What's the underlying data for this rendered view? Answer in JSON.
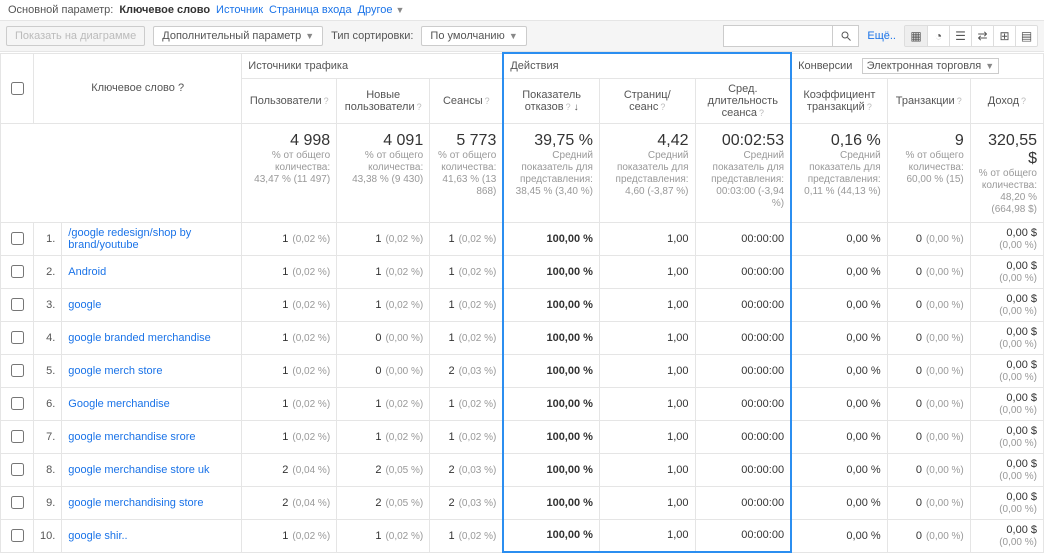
{
  "topbar": {
    "param_label": "Основной параметр:",
    "primary_dim": "Ключевое слово",
    "links": [
      "Источник",
      "Страница входа",
      "Другое"
    ]
  },
  "toolbar": {
    "chart_btn": "Показать на диаграмме",
    "secondary_dim": "Дополнительный параметр",
    "sort_type_label": "Тип сортировки:",
    "sort_default": "По умолчанию",
    "more": "Ещё..",
    "search_placeholder": ""
  },
  "headers": {
    "keyword": "Ключевое слово",
    "group_traffic": "Источники трафика",
    "group_actions": "Действия",
    "group_conv": "Конверсии",
    "conv_select": "Электронная торговля",
    "users": "Пользователи",
    "new_users": "Новые пользователи",
    "sessions": "Сеансы",
    "bounce": "Показатель отказов",
    "pages": "Страниц/сеанс",
    "avg_dur": "Сред. длительность сеанса",
    "trans_rate": "Коэффициент транзакций",
    "trans": "Транзакции",
    "revenue": "Доход"
  },
  "summary": {
    "users": {
      "big": "4 998",
      "l1": "% от общего количества:",
      "l2": "43,47 % (11 497)"
    },
    "new_users": {
      "big": "4 091",
      "l1": "% от общего количества:",
      "l2": "43,38 % (9 430)"
    },
    "sessions": {
      "big": "5 773",
      "l1": "% от общего количества:",
      "l2": "41,63 % (13 868)"
    },
    "bounce": {
      "big": "39,75 %",
      "l1": "Средний показатель для представления:",
      "l2": "38,45 % (3,40 %)"
    },
    "pages": {
      "big": "4,42",
      "l1": "Средний показатель для представления:",
      "l2": "4,60 (-3,87 %)"
    },
    "avg_dur": {
      "big": "00:02:53",
      "l1": "Средний показатель для представления:",
      "l2": "00:03:00 (-3,94 %)"
    },
    "trans_rate": {
      "big": "0,16 %",
      "l1": "Средний показатель для представления:",
      "l2": "0,11 % (44,13 %)"
    },
    "trans": {
      "big": "9",
      "l1": "% от общего количества:",
      "l2": "60,00 % (15)"
    },
    "revenue": {
      "big": "320,55 $",
      "l1": "% от общего количества:",
      "l2": "48,20 % (664,98 $)"
    }
  },
  "rows": [
    {
      "idx": "1.",
      "kw": "/google redesign/shop by brand/youtube",
      "u": "1",
      "u_p": "(0,02 %)",
      "nu": "1",
      "nu_p": "(0,02 %)",
      "s": "1",
      "s_p": "(0,02 %)",
      "b": "100,00 %",
      "pg": "1,00",
      "dur": "00:00:00",
      "tr": "0,00 %",
      "t": "0",
      "t_p": "(0,00 %)",
      "rev": "0,00 $",
      "rev_p": "(0,00 %)"
    },
    {
      "idx": "2.",
      "kw": "Android",
      "u": "1",
      "u_p": "(0,02 %)",
      "nu": "1",
      "nu_p": "(0,02 %)",
      "s": "1",
      "s_p": "(0,02 %)",
      "b": "100,00 %",
      "pg": "1,00",
      "dur": "00:00:00",
      "tr": "0,00 %",
      "t": "0",
      "t_p": "(0,00 %)",
      "rev": "0,00 $",
      "rev_p": "(0,00 %)"
    },
    {
      "idx": "3.",
      "kw": "google",
      "u": "1",
      "u_p": "(0,02 %)",
      "nu": "1",
      "nu_p": "(0,02 %)",
      "s": "1",
      "s_p": "(0,02 %)",
      "b": "100,00 %",
      "pg": "1,00",
      "dur": "00:00:00",
      "tr": "0,00 %",
      "t": "0",
      "t_p": "(0,00 %)",
      "rev": "0,00 $",
      "rev_p": "(0,00 %)"
    },
    {
      "idx": "4.",
      "kw": "google branded merchandise",
      "u": "1",
      "u_p": "(0,02 %)",
      "nu": "0",
      "nu_p": "(0,00 %)",
      "s": "1",
      "s_p": "(0,02 %)",
      "b": "100,00 %",
      "pg": "1,00",
      "dur": "00:00:00",
      "tr": "0,00 %",
      "t": "0",
      "t_p": "(0,00 %)",
      "rev": "0,00 $",
      "rev_p": "(0,00 %)"
    },
    {
      "idx": "5.",
      "kw": "google merch store",
      "u": "1",
      "u_p": "(0,02 %)",
      "nu": "0",
      "nu_p": "(0,00 %)",
      "s": "2",
      "s_p": "(0,03 %)",
      "b": "100,00 %",
      "pg": "1,00",
      "dur": "00:00:00",
      "tr": "0,00 %",
      "t": "0",
      "t_p": "(0,00 %)",
      "rev": "0,00 $",
      "rev_p": "(0,00 %)"
    },
    {
      "idx": "6.",
      "kw": "Google merchandise",
      "u": "1",
      "u_p": "(0,02 %)",
      "nu": "1",
      "nu_p": "(0,02 %)",
      "s": "1",
      "s_p": "(0,02 %)",
      "b": "100,00 %",
      "pg": "1,00",
      "dur": "00:00:00",
      "tr": "0,00 %",
      "t": "0",
      "t_p": "(0,00 %)",
      "rev": "0,00 $",
      "rev_p": "(0,00 %)"
    },
    {
      "idx": "7.",
      "kw": "google merchandise srore",
      "u": "1",
      "u_p": "(0,02 %)",
      "nu": "1",
      "nu_p": "(0,02 %)",
      "s": "1",
      "s_p": "(0,02 %)",
      "b": "100,00 %",
      "pg": "1,00",
      "dur": "00:00:00",
      "tr": "0,00 %",
      "t": "0",
      "t_p": "(0,00 %)",
      "rev": "0,00 $",
      "rev_p": "(0,00 %)"
    },
    {
      "idx": "8.",
      "kw": "google merchandise store uk",
      "u": "2",
      "u_p": "(0,04 %)",
      "nu": "2",
      "nu_p": "(0,05 %)",
      "s": "2",
      "s_p": "(0,03 %)",
      "b": "100,00 %",
      "pg": "1,00",
      "dur": "00:00:00",
      "tr": "0,00 %",
      "t": "0",
      "t_p": "(0,00 %)",
      "rev": "0,00 $",
      "rev_p": "(0,00 %)"
    },
    {
      "idx": "9.",
      "kw": "google merchandising store",
      "u": "2",
      "u_p": "(0,04 %)",
      "nu": "2",
      "nu_p": "(0,05 %)",
      "s": "2",
      "s_p": "(0,03 %)",
      "b": "100,00 %",
      "pg": "1,00",
      "dur": "00:00:00",
      "tr": "0,00 %",
      "t": "0",
      "t_p": "(0,00 %)",
      "rev": "0,00 $",
      "rev_p": "(0,00 %)"
    },
    {
      "idx": "10.",
      "kw": "google shir..",
      "u": "1",
      "u_p": "(0,02 %)",
      "nu": "1",
      "nu_p": "(0,02 %)",
      "s": "1",
      "s_p": "(0,02 %)",
      "b": "100,00 %",
      "pg": "1,00",
      "dur": "00:00:00",
      "tr": "0,00 %",
      "t": "0",
      "t_p": "(0,00 %)",
      "rev": "0,00 $",
      "rev_p": "(0,00 %)"
    }
  ]
}
